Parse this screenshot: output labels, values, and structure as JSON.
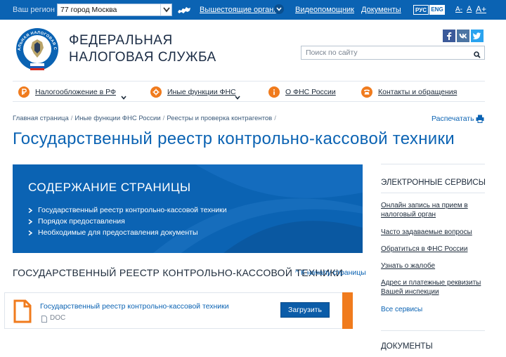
{
  "topbar": {
    "region_label": "Ваш регион",
    "region_value": "77 город Москва",
    "nav": {
      "higher_bodies": "Вышестоящие органы",
      "video_help": "Видеопомощник",
      "documents": "Документы"
    },
    "lang_ru": "РУС",
    "lang_en": "ENG",
    "font_minus": "A-",
    "font_normal": "A",
    "font_plus": "A+"
  },
  "header": {
    "org_name_line1": "ФЕДЕРАЛЬНАЯ",
    "org_name_line2": "НАЛОГОВАЯ СЛУЖБА",
    "logo_text": "ФЕДЕРАЛЬНАЯ НАЛОГОВАЯ СЛУЖБА",
    "search_placeholder": "Поиск по сайту"
  },
  "mainnav": {
    "items": [
      {
        "label": "Налогообложение в РФ",
        "icon": "ruble-icon"
      },
      {
        "label": "Иные функции ФНС",
        "icon": "gear-icon"
      },
      {
        "label": "О ФНС России",
        "icon": "info-icon"
      },
      {
        "label": "Контакты и обращения",
        "icon": "phone-icon"
      }
    ]
  },
  "breadcrumb": {
    "items": [
      "Главная страница",
      "Иные функции ФНС России",
      "Реестры и проверка контрагентов"
    ],
    "separator": "/"
  },
  "print_label": "Распечатать",
  "page_title": "Государственный реестр контрольно-кассовой техники",
  "contents": {
    "title": "СОДЕРЖАНИЕ СТРАНИЦЫ",
    "items": [
      "Государственный реестр контрольно-кассовой техники",
      "Порядок предоставления",
      "Необходимые для предоставления документы"
    ]
  },
  "section": {
    "title": "ГОСУДАРСТВЕННЫЙ РЕЕСТР КОНТРОЛЬНО-КАССОВОЙ ТЕХНИКИ",
    "to_top": "^ К началу страницы",
    "doc": {
      "name": "Государственный реестр контрольно-кассовой техники",
      "format": "DOC",
      "download": "Загрузить"
    }
  },
  "sidebar": {
    "eservices_title": "ЭЛЕКТРОННЫЕ СЕРВИСЫ",
    "links": [
      "Онлайн запись на прием в налоговый орган",
      "Часто задаваемые вопросы",
      "Обратиться в ФНС России",
      "Узнать о жалобе",
      "Адрес и платежные реквизиты Вашей инспекции"
    ],
    "all_services": "Все сервисы",
    "documents_title": "ДОКУМЕНТЫ"
  },
  "colors": {
    "brand_blue": "#0b63b3",
    "accent_orange": "#f07b1d"
  }
}
